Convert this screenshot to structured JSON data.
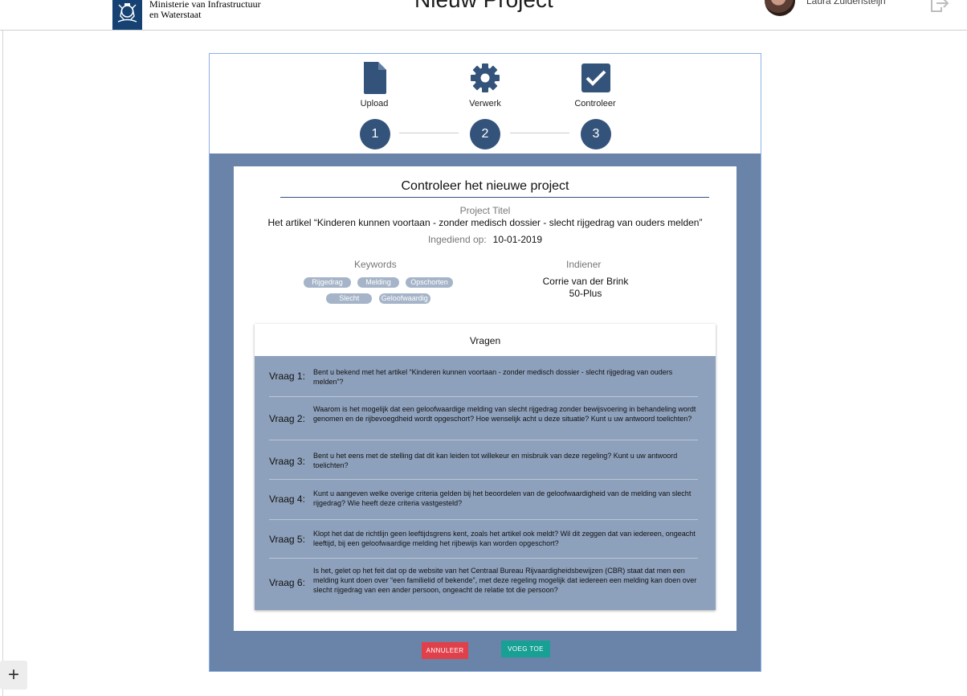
{
  "header": {
    "ministry_line1": "Ministerie van Infrastructuur",
    "ministry_line2": "en Waterstaat",
    "title": "Nieuw Project",
    "user_name": "Laura Zuidensteijn"
  },
  "stepper": {
    "steps": [
      {
        "label": "Upload",
        "number": "1",
        "icon": "file-icon"
      },
      {
        "label": "Verwerk",
        "number": "2",
        "icon": "gear-icon"
      },
      {
        "label": "Controleer",
        "number": "3",
        "icon": "checkbox-icon"
      }
    ]
  },
  "review": {
    "title": "Controleer het nieuwe project",
    "project_title_label": "Project Titel",
    "project_title": "Het artikel “Kinderen kunnen voortaan - zonder medisch dossier - slecht rijgedrag van ouders melden”",
    "submitted_label": "Ingediend op:",
    "submitted_date": "10-01-2019",
    "keywords_label": "Keywords",
    "keywords": [
      "Rijgedrag",
      "Melding",
      "Opschorten",
      "Slecht",
      "Geloofwaardig"
    ],
    "submitter_label": "Indiener",
    "submitter_name": "Corrie van der Brink",
    "submitter_org": "50-Plus"
  },
  "questions": {
    "header": "Vragen",
    "items": [
      {
        "label": "Vraag 1:",
        "text": "Bent u bekend met het artikel “Kinderen kunnen voortaan - zonder medisch dossier - slecht rijgedrag van ouders melden”?"
      },
      {
        "label": "Vraag 2:",
        "text": "Waarom is het mogelijk dat een geloofwaardige melding van slecht rijgedrag zonder bewijsvoering in behandeling wordt genomen en de rijbevoegdheid wordt opgeschort? Hoe wenselijk acht u deze situatie? Kunt u uw antwoord toelichten?"
      },
      {
        "label": "Vraag 3:",
        "text": "Bent u het eens met de stelling dat dit kan leiden tot willekeur en misbruik van deze regeling? Kunt u uw antwoord toelichten?"
      },
      {
        "label": "Vraag 4:",
        "text": "Kunt u aangeven welke overige criteria gelden bij het beoordelen van de geloofwaardigheid van de melding van slecht rijgedrag? Wie heeft deze criteria vastgesteld?"
      },
      {
        "label": "Vraag 5:",
        "text": "Klopt het dat de richtlijn geen leeftijdsgrens kent, zoals het artikel ook meldt? Wil dit zeggen dat van iedereen, ongeacht leeftijd, bij een geloofwaardige melding het rijbewijs kan worden opgeschort?"
      },
      {
        "label": "Vraag 6:",
        "text": "Is het, gelet op het feit dat op de website van het Centraal Bureau Rijvaardigheidsbewijzen (CBR) staat dat men een melding kunt doen over “een familielid of bekende”, met deze regeling mogelijk dat iedereen een melding kan doen over slecht rijgedrag van een ander persoon, ongeacht de relatie tot die persoon?"
      }
    ]
  },
  "actions": {
    "cancel_label": "ANNULEER",
    "add_label": "VOEG TOE"
  },
  "fab": {
    "label": "+"
  }
}
